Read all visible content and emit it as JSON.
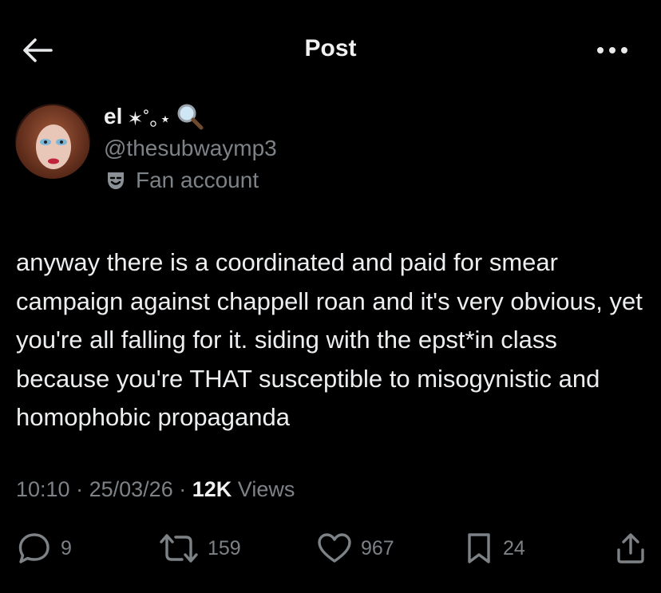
{
  "header": {
    "title": "Post",
    "back_icon": "arrow-left-icon",
    "more_icon": "more-horizontal-icon"
  },
  "author": {
    "name": "el",
    "name_decoration": "✶˚｡⋆",
    "name_emoji": "magnifying-glass-icon",
    "handle": "@thesubwaymp3",
    "affiliation_icon": "theater-mask-icon",
    "affiliation": "Fan account"
  },
  "post": {
    "text": "anyway there is a coordinated and paid for smear campaign against chappell roan and it's very obvious, yet you're all falling for it. siding with the epst*in class because you're THAT susceptible to misogynistic and homophobic propaganda"
  },
  "meta": {
    "time": "10:10",
    "date": "25/03/26",
    "separator": "·",
    "views_count": "12K",
    "views_label": "Views"
  },
  "actions": {
    "replies": "9",
    "reposts": "159",
    "likes": "967",
    "bookmarks": "24"
  },
  "colors": {
    "background": "#000000",
    "primary_text": "#e7e9ea",
    "secondary_text": "#7d8287"
  }
}
